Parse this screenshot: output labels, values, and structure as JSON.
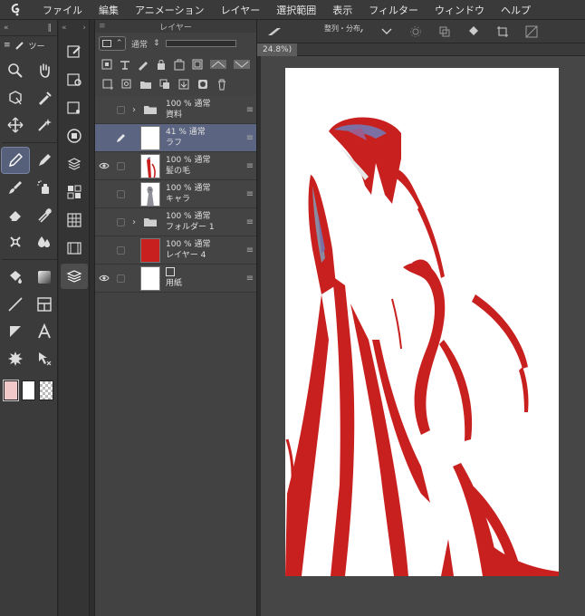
{
  "menubar": {
    "items": [
      "ファイル",
      "編集",
      "アニメーション",
      "レイヤー",
      "選択範囲",
      "表示",
      "フィルター",
      "ウィンドウ",
      "ヘルプ"
    ]
  },
  "tool_panel": {
    "tab_label": "ツー"
  },
  "layer_panel": {
    "title": "レイヤー",
    "blend_mode": "通常",
    "layers": [
      {
        "kind": "folder",
        "name": "資料",
        "opacity_blend": "100 % 通常",
        "visible": false,
        "selected": false
      },
      {
        "kind": "layer",
        "name": "ラフ",
        "opacity_blend": "41 % 通常",
        "visible": false,
        "selected": true,
        "thumb": "checker"
      },
      {
        "kind": "layer",
        "name": "髪の毛",
        "opacity_blend": "100 % 通常",
        "visible": true,
        "selected": false,
        "thumb": "hair"
      },
      {
        "kind": "layer",
        "name": "キャラ",
        "opacity_blend": "100 % 通常",
        "visible": false,
        "selected": false,
        "thumb": "chara"
      },
      {
        "kind": "folder",
        "name": "フォルダー 1",
        "opacity_blend": "100 % 通常",
        "visible": false,
        "selected": false
      },
      {
        "kind": "layer",
        "name": "レイヤー 4",
        "opacity_blend": "100 % 通常",
        "visible": false,
        "selected": false,
        "thumb": "red"
      },
      {
        "kind": "paper",
        "name": "用紙",
        "opacity_blend": "",
        "visible": true,
        "selected": false,
        "thumb": "white"
      }
    ]
  },
  "canvas_toolbar": {
    "tooltip": "整列・分布"
  },
  "canvas": {
    "tab_label": "24.8%)"
  },
  "colors": {
    "accent_selection": "#5b6480",
    "hair_red": "#c8201f",
    "panel_bg": "#424242"
  }
}
